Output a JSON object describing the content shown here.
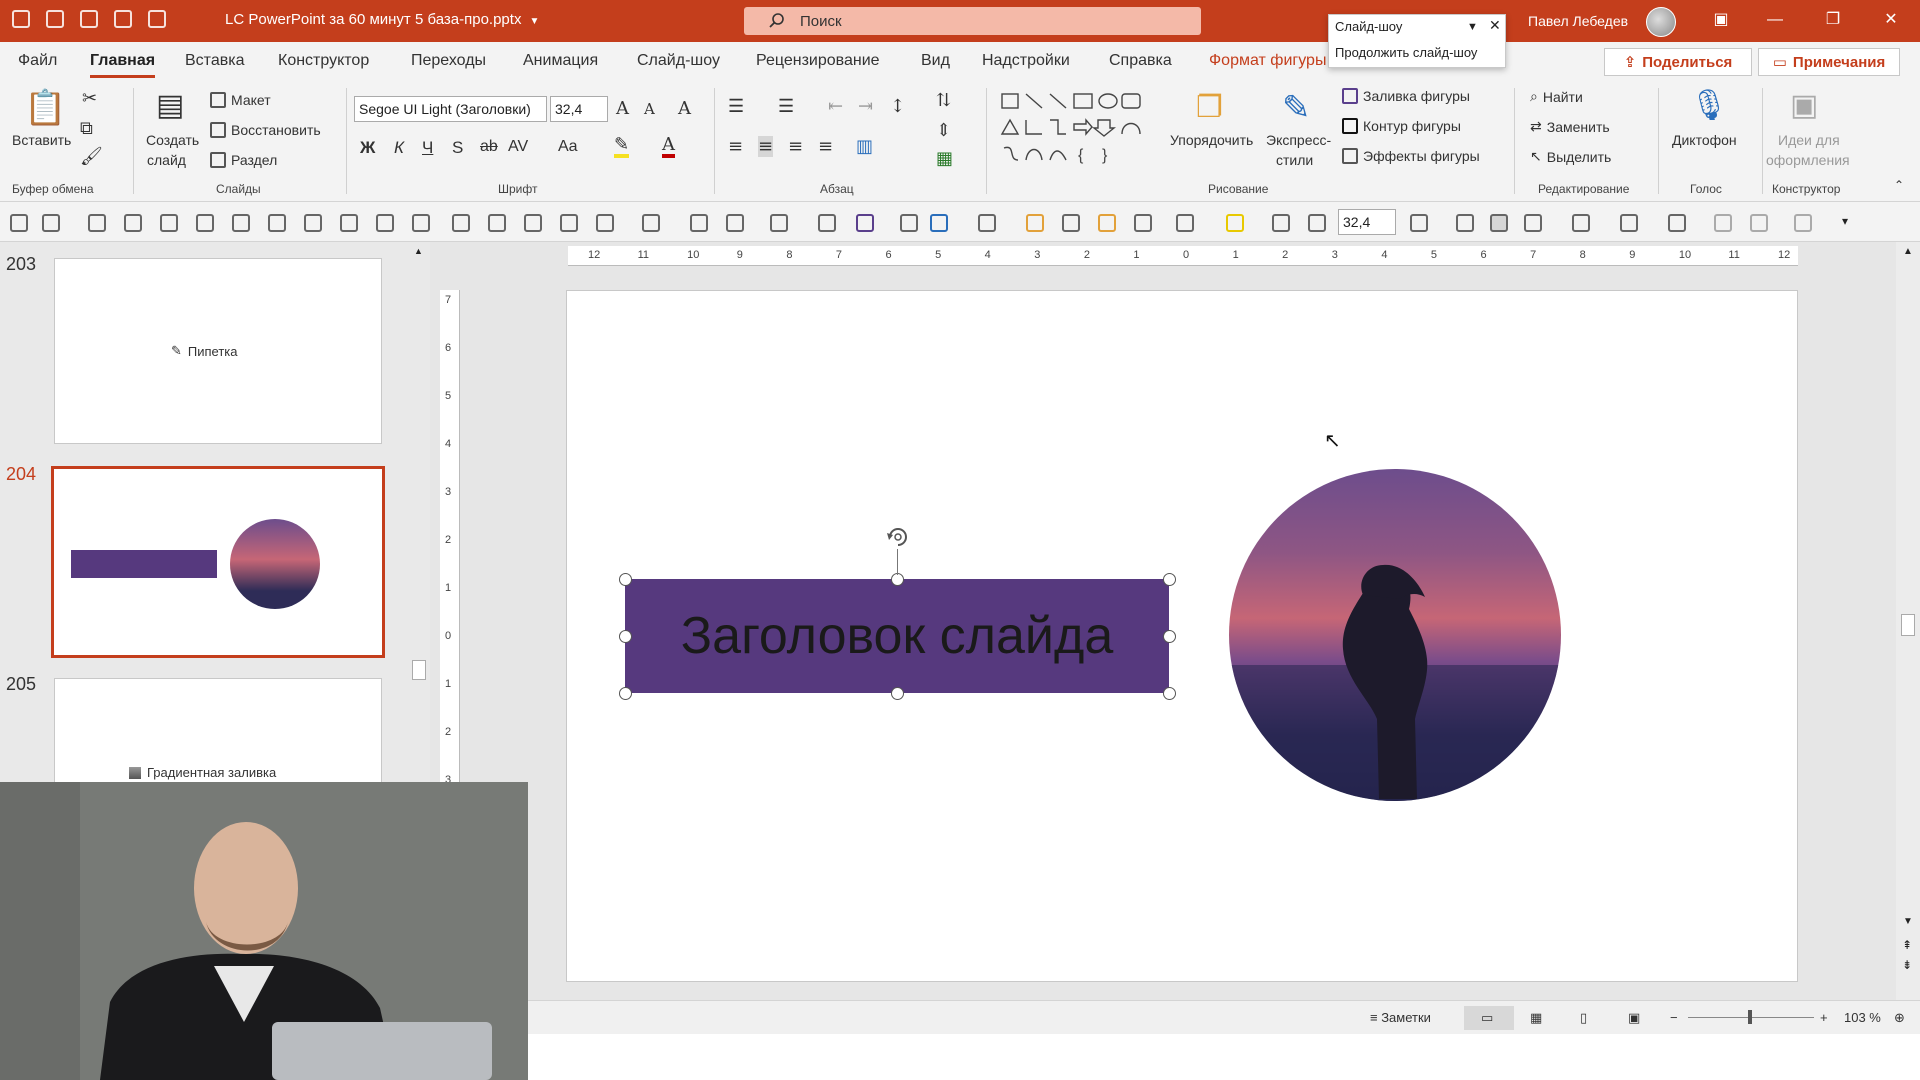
{
  "window": {
    "title": "LC PowerPoint за 60 минут 5 база-про.pptx",
    "search_placeholder": "Поиск",
    "user_name": "Павел Лебедев",
    "accent_color": "#c43e1c"
  },
  "slideshow_popup": {
    "title": "Слайд-шоу",
    "continue": "Продолжить слайд-шоу"
  },
  "tabs": [
    "Файл",
    "Главная",
    "Вставка",
    "Конструктор",
    "Переходы",
    "Анимация",
    "Слайд-шоу",
    "Рецензирование",
    "Вид",
    "Надстройки",
    "Справка",
    "Формат фигуры"
  ],
  "share_label": "Поделиться",
  "comments_label": "Примечания",
  "ribbon": {
    "clipboard": {
      "paste": "Вставить",
      "group": "Буфер обмена"
    },
    "slides": {
      "new_slide_1": "Создать",
      "new_slide_2": "слайд",
      "layout": "Макет",
      "reset": "Восстановить",
      "section": "Раздел",
      "group": "Слайды"
    },
    "font": {
      "name": "Segoe UI Light (Заголовки)",
      "size": "32,4",
      "group": "Шрифт",
      "bold": "Ж",
      "italic": "К",
      "underline": "Ч",
      "shadow": "S",
      "strike": "ab",
      "spacing": "AV",
      "case": "Aa"
    },
    "paragraph": {
      "group": "Абзац"
    },
    "drawing": {
      "arrange": "Упорядочить",
      "styles_1": "Экспресс-",
      "styles_2": "стили",
      "fill": "Заливка фигуры",
      "outline": "Контур фигуры",
      "effects": "Эффекты фигуры",
      "group": "Рисование"
    },
    "editing": {
      "find": "Найти",
      "replace": "Заменить",
      "select": "Выделить",
      "group": "Редактирование"
    },
    "voice": {
      "dictate": "Диктофон",
      "group": "Голос"
    },
    "designer": {
      "ideas_1": "Идеи для",
      "ideas_2": "оформления",
      "group": "Конструктор"
    }
  },
  "format_toolbar": {
    "font_size": "32,4"
  },
  "slides_panel": [
    {
      "number": "203",
      "caption": "Пипетка"
    },
    {
      "number": "204",
      "caption": ""
    },
    {
      "number": "205",
      "caption": "Градиентная заливка"
    }
  ],
  "ruler_h": [
    "12",
    "11",
    "10",
    "9",
    "8",
    "7",
    "6",
    "5",
    "4",
    "3",
    "2",
    "1",
    "0",
    "1",
    "2",
    "3",
    "4",
    "5",
    "6",
    "7",
    "8",
    "9",
    "10",
    "11",
    "12"
  ],
  "ruler_v": [
    "7",
    "6",
    "5",
    "4",
    "3",
    "2",
    "1",
    "0",
    "1",
    "2",
    "3"
  ],
  "slide": {
    "title_text": "Заголовок слайда",
    "title_fill": "#56397e"
  },
  "statusbar": {
    "notes": "Заметки",
    "zoom": "103 %"
  }
}
